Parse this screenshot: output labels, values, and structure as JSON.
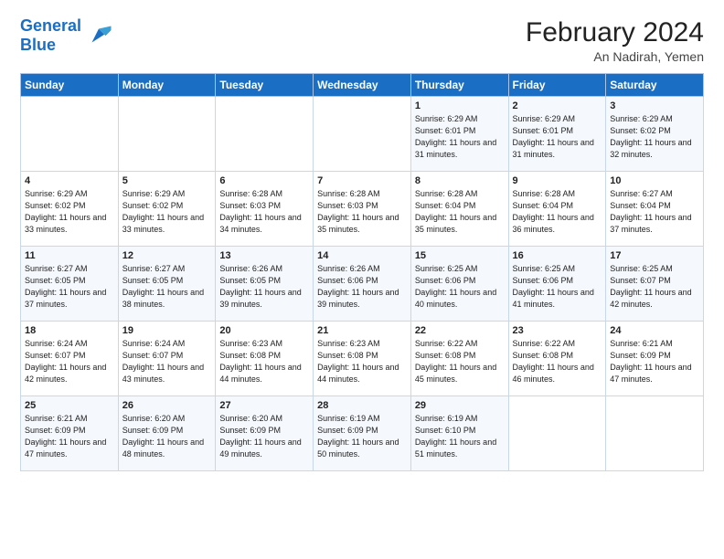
{
  "header": {
    "logo_line1": "General",
    "logo_line2": "Blue",
    "title": "February 2024",
    "subtitle": "An Nadirah, Yemen"
  },
  "days_of_week": [
    "Sunday",
    "Monday",
    "Tuesday",
    "Wednesday",
    "Thursday",
    "Friday",
    "Saturday"
  ],
  "weeks": [
    [
      {
        "day": "",
        "info": ""
      },
      {
        "day": "",
        "info": ""
      },
      {
        "day": "",
        "info": ""
      },
      {
        "day": "",
        "info": ""
      },
      {
        "day": "1",
        "info": "Sunrise: 6:29 AM\nSunset: 6:01 PM\nDaylight: 11 hours and 31 minutes."
      },
      {
        "day": "2",
        "info": "Sunrise: 6:29 AM\nSunset: 6:01 PM\nDaylight: 11 hours and 31 minutes."
      },
      {
        "day": "3",
        "info": "Sunrise: 6:29 AM\nSunset: 6:02 PM\nDaylight: 11 hours and 32 minutes."
      }
    ],
    [
      {
        "day": "4",
        "info": "Sunrise: 6:29 AM\nSunset: 6:02 PM\nDaylight: 11 hours and 33 minutes."
      },
      {
        "day": "5",
        "info": "Sunrise: 6:29 AM\nSunset: 6:02 PM\nDaylight: 11 hours and 33 minutes."
      },
      {
        "day": "6",
        "info": "Sunrise: 6:28 AM\nSunset: 6:03 PM\nDaylight: 11 hours and 34 minutes."
      },
      {
        "day": "7",
        "info": "Sunrise: 6:28 AM\nSunset: 6:03 PM\nDaylight: 11 hours and 35 minutes."
      },
      {
        "day": "8",
        "info": "Sunrise: 6:28 AM\nSunset: 6:04 PM\nDaylight: 11 hours and 35 minutes."
      },
      {
        "day": "9",
        "info": "Sunrise: 6:28 AM\nSunset: 6:04 PM\nDaylight: 11 hours and 36 minutes."
      },
      {
        "day": "10",
        "info": "Sunrise: 6:27 AM\nSunset: 6:04 PM\nDaylight: 11 hours and 37 minutes."
      }
    ],
    [
      {
        "day": "11",
        "info": "Sunrise: 6:27 AM\nSunset: 6:05 PM\nDaylight: 11 hours and 37 minutes."
      },
      {
        "day": "12",
        "info": "Sunrise: 6:27 AM\nSunset: 6:05 PM\nDaylight: 11 hours and 38 minutes."
      },
      {
        "day": "13",
        "info": "Sunrise: 6:26 AM\nSunset: 6:05 PM\nDaylight: 11 hours and 39 minutes."
      },
      {
        "day": "14",
        "info": "Sunrise: 6:26 AM\nSunset: 6:06 PM\nDaylight: 11 hours and 39 minutes."
      },
      {
        "day": "15",
        "info": "Sunrise: 6:25 AM\nSunset: 6:06 PM\nDaylight: 11 hours and 40 minutes."
      },
      {
        "day": "16",
        "info": "Sunrise: 6:25 AM\nSunset: 6:06 PM\nDaylight: 11 hours and 41 minutes."
      },
      {
        "day": "17",
        "info": "Sunrise: 6:25 AM\nSunset: 6:07 PM\nDaylight: 11 hours and 42 minutes."
      }
    ],
    [
      {
        "day": "18",
        "info": "Sunrise: 6:24 AM\nSunset: 6:07 PM\nDaylight: 11 hours and 42 minutes."
      },
      {
        "day": "19",
        "info": "Sunrise: 6:24 AM\nSunset: 6:07 PM\nDaylight: 11 hours and 43 minutes."
      },
      {
        "day": "20",
        "info": "Sunrise: 6:23 AM\nSunset: 6:08 PM\nDaylight: 11 hours and 44 minutes."
      },
      {
        "day": "21",
        "info": "Sunrise: 6:23 AM\nSunset: 6:08 PM\nDaylight: 11 hours and 44 minutes."
      },
      {
        "day": "22",
        "info": "Sunrise: 6:22 AM\nSunset: 6:08 PM\nDaylight: 11 hours and 45 minutes."
      },
      {
        "day": "23",
        "info": "Sunrise: 6:22 AM\nSunset: 6:08 PM\nDaylight: 11 hours and 46 minutes."
      },
      {
        "day": "24",
        "info": "Sunrise: 6:21 AM\nSunset: 6:09 PM\nDaylight: 11 hours and 47 minutes."
      }
    ],
    [
      {
        "day": "25",
        "info": "Sunrise: 6:21 AM\nSunset: 6:09 PM\nDaylight: 11 hours and 47 minutes."
      },
      {
        "day": "26",
        "info": "Sunrise: 6:20 AM\nSunset: 6:09 PM\nDaylight: 11 hours and 48 minutes."
      },
      {
        "day": "27",
        "info": "Sunrise: 6:20 AM\nSunset: 6:09 PM\nDaylight: 11 hours and 49 minutes."
      },
      {
        "day": "28",
        "info": "Sunrise: 6:19 AM\nSunset: 6:09 PM\nDaylight: 11 hours and 50 minutes."
      },
      {
        "day": "29",
        "info": "Sunrise: 6:19 AM\nSunset: 6:10 PM\nDaylight: 11 hours and 51 minutes."
      },
      {
        "day": "",
        "info": ""
      },
      {
        "day": "",
        "info": ""
      }
    ]
  ]
}
